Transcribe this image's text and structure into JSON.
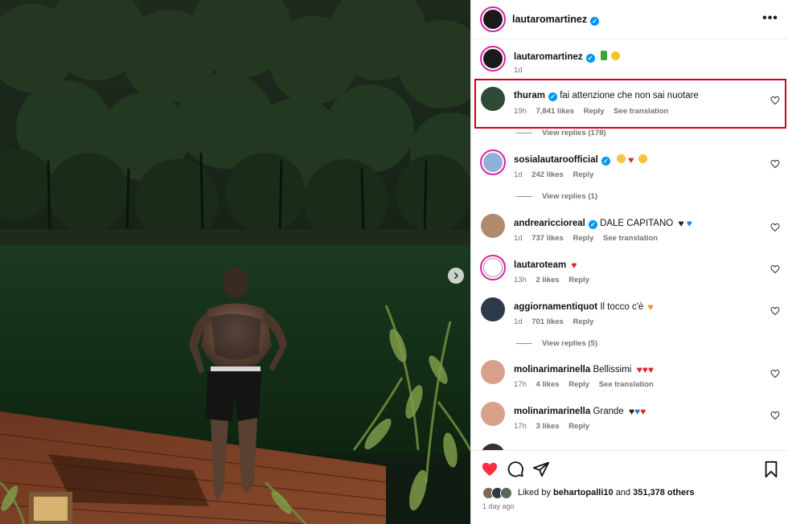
{
  "post": {
    "author": "lautaromartinez",
    "verified": true,
    "caption_time": "1d",
    "liked_by_prefix": "Liked by",
    "liked_by_user": "behartopalli10",
    "liked_by_and": "and",
    "liked_by_others": "351,378 others",
    "time_ago": "1 day ago"
  },
  "labels": {
    "reply": "Reply",
    "see_translation": "See translation"
  },
  "comments": [
    {
      "user": "thuram",
      "verified": true,
      "text": "fai attenzione che non sai nuotare",
      "time": "19h",
      "likes": "7,841 likes",
      "replies": "View replies (178)",
      "highlighted": true
    },
    {
      "user": "sosialautaroofficial",
      "verified": true,
      "text": "",
      "emojis": [
        "muscle",
        "heart-red",
        "smile"
      ],
      "time": "1d",
      "likes": "242 likes",
      "replies": "View replies (1)"
    },
    {
      "user": "andreariccioreal",
      "verified": true,
      "text": "DALE CAPITANO",
      "emojis": [
        "heart-black",
        "heart-blue"
      ],
      "time": "1d",
      "likes": "737 likes"
    },
    {
      "user": "lautaroteam",
      "verified": false,
      "text": "",
      "emojis": [
        "heart-red"
      ],
      "time": "13h",
      "likes": "2 likes"
    },
    {
      "user": "aggiornamentiquot",
      "verified": false,
      "text": "Il tocco c'è",
      "emojis": [
        "heart-orange"
      ],
      "time": "1d",
      "likes": "701 likes",
      "replies": "View replies (5)"
    },
    {
      "user": "molinarimarinella",
      "verified": false,
      "text": "Bellissimi",
      "emojis": [
        "heart-red",
        "heart-red",
        "heart-red"
      ],
      "time": "17h",
      "likes": "4 likes"
    },
    {
      "user": "molinarimarinella",
      "verified": false,
      "text": "Grande",
      "emojis": [
        "heart-black",
        "heart-blue",
        "heart-red"
      ],
      "time": "17h",
      "likes": "3 likes"
    }
  ],
  "colors": {
    "highlight_border": "#d0021b",
    "verified_badge": "#0095f6",
    "like_red": "#ff3040",
    "secondary_text": "#737373"
  }
}
